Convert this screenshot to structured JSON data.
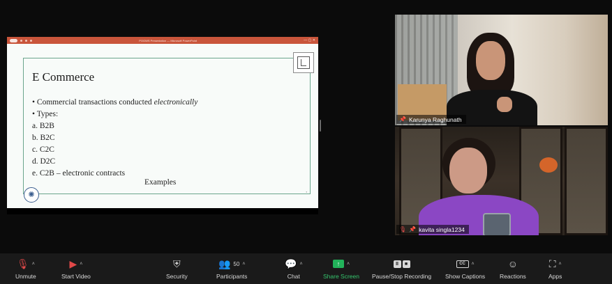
{
  "share": {
    "window_title": "POGWS Presentation — Microsoft PowerPoint",
    "slide": {
      "title": "E Commerce",
      "bullets": {
        "line1_prefix": "• Commercial transactions conducted ",
        "line1_emph": "electronically",
        "line2": "• Types:",
        "types": [
          "a.   B2B",
          "b.   B2C",
          "c.   C2C",
          "d.   D2C",
          "e.   C2B – electronic contracts"
        ]
      },
      "examples": "Examples"
    }
  },
  "participants": [
    {
      "name": "Karunya Raghunath"
    },
    {
      "name": "kavita singla1234"
    }
  ],
  "toolbar": {
    "unmute": "Unmute",
    "start_video": "Start Video",
    "security": "Security",
    "participants": "Participants",
    "participants_count": "50",
    "chat": "Chat",
    "share_screen": "Share Screen",
    "record": "Pause/Stop Recording",
    "captions": "Show Captions",
    "reactions": "Reactions",
    "apps": "Apps"
  },
  "colors": {
    "share_screen_accent": "#22b25a",
    "muted_red": "#e04848",
    "slide_frame": "#6aa58c"
  }
}
